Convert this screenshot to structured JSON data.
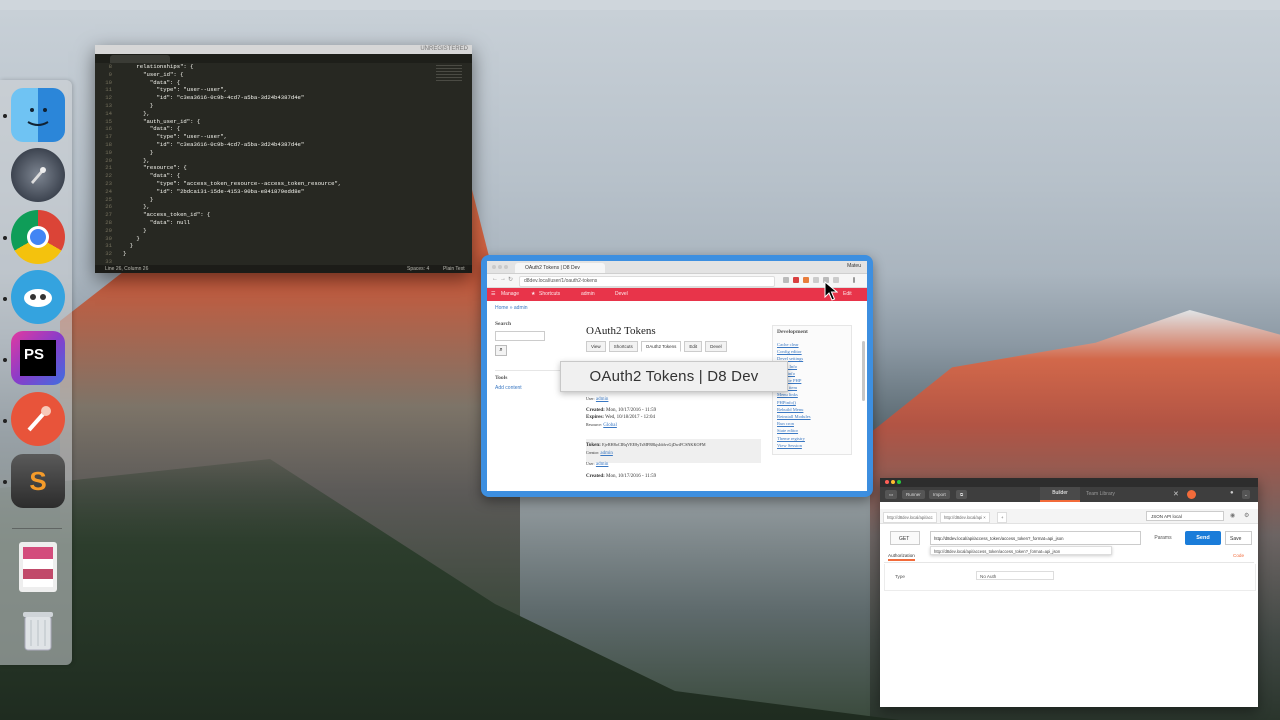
{
  "dock": {
    "apps": [
      {
        "name": "finder-icon",
        "color": "#3a8fe5"
      },
      {
        "name": "launchpad-icon",
        "color": "#3a3f48"
      },
      {
        "name": "chrome-icon",
        "color": "#e8e8e8"
      },
      {
        "name": "tweetbot-icon",
        "color": "#3aa0e0"
      },
      {
        "name": "phpstorm-icon",
        "color": "#8a3cc9"
      },
      {
        "name": "paw-icon",
        "color": "#e8543a"
      },
      {
        "name": "sublime-text-icon",
        "color": "#4a4a4a"
      }
    ],
    "stack_icon": "documents-stack-icon",
    "trash_icon": "trash-icon"
  },
  "sublime": {
    "unregistered": "UNREGISTERED",
    "line_numbers": [
      "8",
      "9",
      "10",
      "11",
      "12",
      "13",
      "14",
      "15",
      "16",
      "17",
      "18",
      "19",
      "20",
      "21",
      "22",
      "23",
      "24",
      "25",
      "26",
      "27",
      "28",
      "29",
      "30",
      "31",
      "32",
      "33"
    ],
    "code_lines": [
      "    relationships\": {",
      "      \"user_id\": {",
      "        \"data\": {",
      "          \"type\": \"user--user\",",
      "          \"id\": \"c3ea3616-0c9b-4cd7-a5ba-3d24b4387d4e\"",
      "        }",
      "      },",
      "      \"auth_user_id\": {",
      "        \"data\": {",
      "          \"type\": \"user--user\",",
      "          \"id\": \"c3ea3616-0c9b-4cd7-a5ba-3d24b4387d4e\"",
      "        }",
      "      },",
      "      \"resource\": {",
      "        \"data\": {",
      "          \"type\": \"access_token_resource--access_token_resource\",",
      "          \"id\": \"2bdca131-15de-4153-90ba-e841879edd8e\"",
      "        }",
      "      },",
      "      \"access_token_id\": {",
      "        \"data\": null",
      "      }",
      "    }",
      "  }",
      "}",
      ""
    ],
    "status_left": "Line 26, Column 26",
    "status_spaces": "Spaces: 4",
    "status_syntax": "Plain Text"
  },
  "browser": {
    "tab_title": "OAuth2 Tokens | D8 Dev",
    "user": "Mateu",
    "url": "d8dev.local/user/1/oauth2-tokens",
    "admin_items": [
      "Manage",
      "Shortcuts",
      "admin",
      "Devel"
    ],
    "admin_right": "Edit",
    "breadcrumb": "Home » admin",
    "search_title": "Search",
    "tools_title": "Tools",
    "add_content": "Add content",
    "page_title": "OAuth2 Tokens",
    "tabs": [
      "View",
      "Shortcuts",
      "OAuth2 Tokens",
      "Edit",
      "Devel"
    ],
    "tooltip": "OAuth2 Tokens | D8 Dev",
    "entry1": {
      "user_label": "User:",
      "user_value": "admin",
      "created_label": "Created:",
      "created_value": "Mon, 10/17/2016 - 11:59",
      "expires_label": "Expires:",
      "expires_value": "Wed, 10/18/2017 - 12:04",
      "resource_label": "Resource:",
      "resource_value": "Global"
    },
    "entry2": {
      "token_label": "Token:",
      "token_value": "EjvRH8oCIRqVEE8yTsMFR8kjsIddvcGjDwiFCSNKKOFM",
      "creator_label": "Creator:",
      "creator_value": "admin",
      "user_label": "User:",
      "user_value": "admin",
      "created_label": "Created:",
      "created_value": "Mon, 10/17/2016 - 11:59"
    },
    "development_title": "Development",
    "dev_links": [
      "Cache clear",
      "Config editor",
      "Devel settings",
      "Entity Info",
      "Field info",
      "Execute PHP",
      "Menu item",
      "Menu links",
      "PHPinfo()",
      "Rebuild Menu",
      "Reinstall Modules",
      "Run cron",
      "State editor",
      "Theme registry",
      "View Session"
    ]
  },
  "postman": {
    "runner": "Runner",
    "import": "Import",
    "builder": "Builder",
    "team_library": "Team Library",
    "request_tabs": [
      "http://d8dev.local/api/acc",
      "http://d8dev.local/api"
    ],
    "environment": "JSON API local",
    "method": "GET",
    "url": "http://d8dev.local/api/access_token/access_token?_format=api_json",
    "suggestion": "http://d8dev.local/api/access_token/access_token?_format=api_json",
    "params": "Params",
    "send": "Send",
    "save": "Save",
    "authorization_tab": "Authorization",
    "code_link": "Code",
    "type_label": "Type",
    "type_value": "No Auth"
  }
}
